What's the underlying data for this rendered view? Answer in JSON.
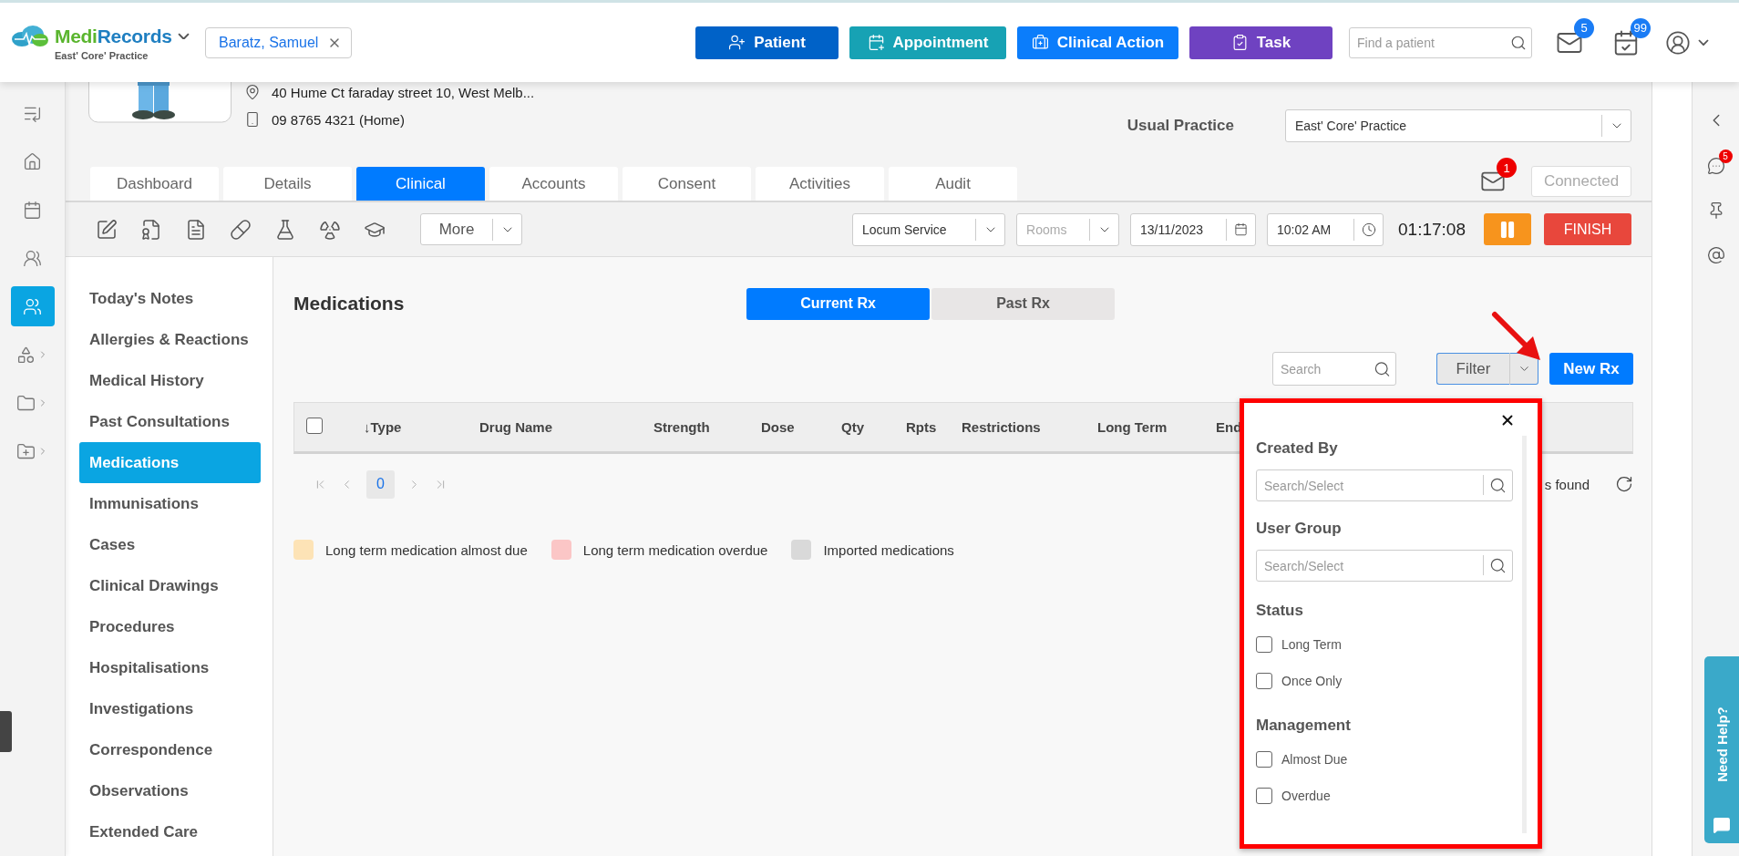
{
  "header": {
    "brand": {
      "part_1": "Medi",
      "part_2": "Records",
      "practice": "East' Core' Practice"
    },
    "patient_chip": {
      "name": "Baratz, Samuel"
    },
    "actions": [
      {
        "label": "Patient",
        "kind": "patient",
        "color": "#0062c8"
      },
      {
        "label": "Appointment",
        "kind": "appointment",
        "color": "#17a2b4"
      },
      {
        "label": "Clinical Action",
        "kind": "clinical",
        "color": "#0b7dfb"
      },
      {
        "label": "Task",
        "kind": "task",
        "color": "#6f42c1"
      }
    ],
    "search": {
      "placeholder": "Find a patient"
    },
    "notifications": [
      {
        "kind": "mail",
        "count": "5"
      },
      {
        "kind": "tasks",
        "count": "99"
      }
    ]
  },
  "rail": [
    {
      "kind": "menu",
      "selected": false,
      "expandable": false
    },
    {
      "kind": "home",
      "selected": false,
      "expandable": false
    },
    {
      "kind": "calendar",
      "selected": false,
      "expandable": false
    },
    {
      "kind": "contacts",
      "selected": false,
      "expandable": false
    },
    {
      "kind": "patients",
      "selected": true,
      "expandable": false
    },
    {
      "kind": "apps",
      "selected": false,
      "expandable": true
    },
    {
      "kind": "folder",
      "selected": false,
      "expandable": true
    },
    {
      "kind": "new_folder",
      "selected": false,
      "expandable": true
    }
  ],
  "patient": {
    "address": "40 Hume Ct faraday street 10, West Melb...",
    "phone": "09 8765 4321 (Home)",
    "usual_practice": {
      "label": "Usual Practice",
      "value": "East' Core' Practice"
    }
  },
  "tabs": [
    {
      "label": "Dashboard",
      "selected": false
    },
    {
      "label": "Details",
      "selected": false
    },
    {
      "label": "Clinical",
      "selected": true
    },
    {
      "label": "Accounts",
      "selected": false
    },
    {
      "label": "Consent",
      "selected": false
    },
    {
      "label": "Activities",
      "selected": false
    },
    {
      "label": "Audit",
      "selected": false
    }
  ],
  "messages": {
    "count": "1"
  },
  "connection": {
    "label": "Connected",
    "disabled": true
  },
  "toolbar": {
    "more": "More",
    "service": "Locum Service",
    "rooms": {
      "placeholder": "Rooms"
    },
    "date": "13/11/2023",
    "time": "10:02 AM",
    "timer": "01:17:08",
    "finish": "FINISH"
  },
  "nav": [
    {
      "label": "Today's Notes",
      "selected": false
    },
    {
      "label": "Allergies & Reactions",
      "selected": false
    },
    {
      "label": "Medical History",
      "selected": false
    },
    {
      "label": "Past Consultations",
      "selected": false
    },
    {
      "label": "Medications",
      "selected": true
    },
    {
      "label": "Immunisations",
      "selected": false
    },
    {
      "label": "Cases",
      "selected": false
    },
    {
      "label": "Clinical Drawings",
      "selected": false
    },
    {
      "label": "Procedures",
      "selected": false
    },
    {
      "label": "Hospitalisations",
      "selected": false
    },
    {
      "label": "Investigations",
      "selected": false
    },
    {
      "label": "Correspondence",
      "selected": false
    },
    {
      "label": "Observations",
      "selected": false
    },
    {
      "label": "Extended Care",
      "selected": false
    }
  ],
  "medications": {
    "title": "Medications",
    "views": [
      {
        "label": "Current Rx",
        "selected": true
      },
      {
        "label": "Past Rx",
        "selected": false
      }
    ],
    "search": {
      "placeholder": "Search"
    },
    "filter": "Filter",
    "new_button": "New Rx",
    "select_all": {
      "checked": false
    },
    "columns": [
      "↓Type",
      "Drug Name",
      "Strength",
      "Dose",
      "Qty",
      "Rpts",
      "Restrictions",
      "Long Term",
      "End"
    ],
    "pager": {
      "page": "0"
    },
    "result_text": "s found",
    "legend": [
      {
        "label": "Long term medication almost due",
        "color": "#fde3b6"
      },
      {
        "label": "Long term medication overdue",
        "color": "#fbc6c6"
      },
      {
        "label": "Imported medications",
        "color": "#d9d9d9"
      }
    ]
  },
  "filter_panel": {
    "sections": [
      {
        "kind": "search",
        "title": "Created By",
        "placeholder": "Search/Select"
      },
      {
        "kind": "search",
        "title": "User Group",
        "placeholder": "Search/Select"
      },
      {
        "kind": "checks",
        "title": "Status",
        "options": [
          {
            "label": "Long Term",
            "checked": false
          },
          {
            "label": "Once Only",
            "checked": false
          }
        ]
      },
      {
        "kind": "checks",
        "title": "Management",
        "options": [
          {
            "label": "Almost Due",
            "checked": false
          },
          {
            "label": "Overdue",
            "checked": false
          }
        ]
      }
    ]
  },
  "right_rail": {
    "chat_count": "5"
  },
  "help": {
    "label": "Need Help?"
  }
}
